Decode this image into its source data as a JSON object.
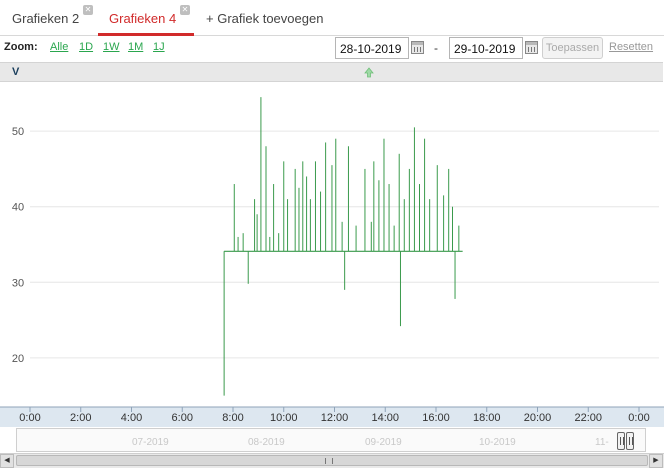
{
  "tabs": [
    {
      "label": "Grafieken 2",
      "active": false
    },
    {
      "label": "Grafieken 4",
      "active": true
    }
  ],
  "add_tab_label": "+ Grafiek toevoegen",
  "toolbar": {
    "zoom_label": "Zoom:",
    "zoom_options": [
      "Alle",
      "1D",
      "1W",
      "1M",
      "1J"
    ],
    "date_from": "28-10-2019",
    "date_separator": "-",
    "date_to": "29-10-2019",
    "apply_label": "Toepassen",
    "reset_label": "Resetten"
  },
  "chart_header": {
    "unit": "V"
  },
  "colors": {
    "accent": "#d12a2a",
    "link": "#2aa64e",
    "series": "#3a9a4c"
  },
  "chart_data": {
    "type": "line",
    "ylabel": "V",
    "ylim": [
      13.5,
      56.5
    ],
    "yticks": [
      "20",
      "30",
      "40",
      "50"
    ],
    "xlim": [
      0,
      24
    ],
    "xticks": [
      "0:00",
      "2:00",
      "4:00",
      "6:00",
      "8:00",
      "10:00",
      "12:00",
      "14:00",
      "16:00",
      "18:00",
      "20:00",
      "22:00",
      "0:00"
    ],
    "grid": true,
    "series": [
      {
        "baseline": 34.1,
        "x_range": [
          7.65,
          17.05
        ],
        "start_dip": {
          "x": 7.65,
          "y": 15.0
        },
        "spikes": [
          {
            "x": 8.05,
            "y": 43.0
          },
          {
            "x": 8.2,
            "y": 36.0
          },
          {
            "x": 8.4,
            "y": 36.5
          },
          {
            "x": 8.85,
            "y": 41.0
          },
          {
            "x": 8.95,
            "y": 39.0
          },
          {
            "x": 9.1,
            "y": 54.5
          },
          {
            "x": 9.3,
            "y": 48.0
          },
          {
            "x": 9.45,
            "y": 36.0
          },
          {
            "x": 9.6,
            "y": 43.0
          },
          {
            "x": 9.8,
            "y": 36.5
          },
          {
            "x": 10.0,
            "y": 46.0
          },
          {
            "x": 10.15,
            "y": 41.0
          },
          {
            "x": 10.45,
            "y": 45.0
          },
          {
            "x": 10.6,
            "y": 42.5
          },
          {
            "x": 10.75,
            "y": 46.0
          },
          {
            "x": 10.9,
            "y": 44.0
          },
          {
            "x": 11.05,
            "y": 41.0
          },
          {
            "x": 11.25,
            "y": 46.0
          },
          {
            "x": 11.45,
            "y": 42.0
          },
          {
            "x": 11.65,
            "y": 48.5
          },
          {
            "x": 11.9,
            "y": 45.5
          },
          {
            "x": 12.05,
            "y": 49.0
          },
          {
            "x": 12.3,
            "y": 38.0
          },
          {
            "x": 12.55,
            "y": 48.0
          },
          {
            "x": 12.85,
            "y": 37.5
          },
          {
            "x": 13.2,
            "y": 45.0
          },
          {
            "x": 13.45,
            "y": 38.0
          },
          {
            "x": 13.55,
            "y": 46.0
          },
          {
            "x": 13.75,
            "y": 43.5
          },
          {
            "x": 13.95,
            "y": 49.0
          },
          {
            "x": 14.15,
            "y": 43.0
          },
          {
            "x": 14.35,
            "y": 37.5
          },
          {
            "x": 14.55,
            "y": 47.0
          },
          {
            "x": 14.75,
            "y": 41.0
          },
          {
            "x": 14.95,
            "y": 45.0
          },
          {
            "x": 15.15,
            "y": 50.5
          },
          {
            "x": 15.35,
            "y": 43.0
          },
          {
            "x": 15.55,
            "y": 49.0
          },
          {
            "x": 15.75,
            "y": 41.0
          },
          {
            "x": 16.05,
            "y": 45.5
          },
          {
            "x": 16.3,
            "y": 41.5
          },
          {
            "x": 16.5,
            "y": 45.0
          },
          {
            "x": 16.65,
            "y": 40.0
          },
          {
            "x": 16.9,
            "y": 37.5
          }
        ],
        "dips": [
          {
            "x": 8.6,
            "y": 29.8
          },
          {
            "x": 12.4,
            "y": 29.0
          },
          {
            "x": 14.6,
            "y": 24.2
          },
          {
            "x": 16.75,
            "y": 27.8
          }
        ]
      }
    ]
  },
  "navigator": {
    "months": [
      "07-2019",
      "08-2019",
      "09-2019",
      "10-2019",
      "11-"
    ]
  },
  "scrollbar": {
    "left_arrow": "◀",
    "right_arrow": "▶"
  }
}
